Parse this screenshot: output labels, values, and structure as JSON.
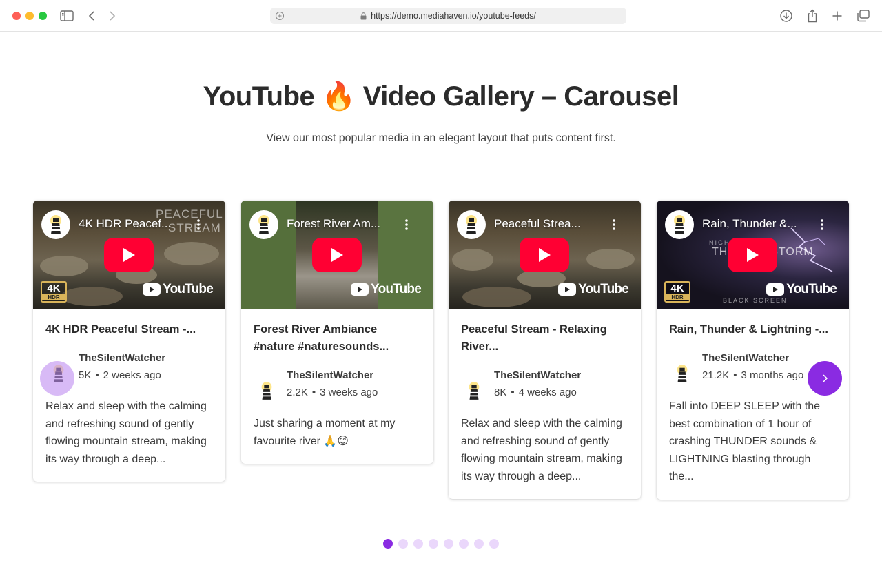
{
  "browser": {
    "url": "https://demo.mediahaven.io/youtube-feeds/"
  },
  "page": {
    "title": "YouTube 🔥 Video Gallery – Carousel",
    "subtitle": "View our most popular media in an elegant layout that puts content first."
  },
  "cards": [
    {
      "thumb_title": "4K HDR Peacef...",
      "overlay_line1": "PEACEFUL",
      "overlay_line2": "STREAM",
      "title": "4K HDR Peaceful Stream -...",
      "channel": "TheSilentWatcher",
      "views": "5K",
      "age": "2 weeks ago",
      "description": "Relax and sleep with the calming and refreshing sound of gently flowing mountain stream, making its way through a deep..."
    },
    {
      "thumb_title": "Forest River Am...",
      "title": "Forest River Ambiance #nature #naturesounds...",
      "channel": "TheSilentWatcher",
      "views": "2.2K",
      "age": "3 weeks ago",
      "description": "Just sharing a moment at my favourite river 🙏😊"
    },
    {
      "thumb_title": "Peaceful Strea...",
      "title": "Peaceful Stream - Relaxing River...",
      "channel": "TheSilentWatcher",
      "views": "8K",
      "age": "4 weeks ago",
      "description": "Relax and sleep with the calming and refreshing sound of gently flowing mountain stream, making its way through a deep..."
    },
    {
      "thumb_title": "Rain, Thunder &...",
      "overlay_line1": "NIGHTTIME",
      "overlay_line2": "THUNDERSTORM",
      "overlay_line3": "BLACK SCREEN",
      "title": "Rain, Thunder & Lightning -...",
      "channel": "TheSilentWatcher",
      "views": "21.2K",
      "age": "3 months ago",
      "description": "Fall into DEEP SLEEP with the best combination of 1 hour of crashing THUNDER sounds & LIGHTNING blasting through the..."
    }
  ],
  "badges": {
    "k": "4K",
    "hdr": "HDR",
    "youtube": "YouTube"
  },
  "separator": "•",
  "pagination": {
    "total": 8,
    "active_index": 0
  },
  "colors": {
    "accent": "#8a2be2",
    "accent_light": "#ead7fb",
    "youtube_red": "#ff0033"
  }
}
